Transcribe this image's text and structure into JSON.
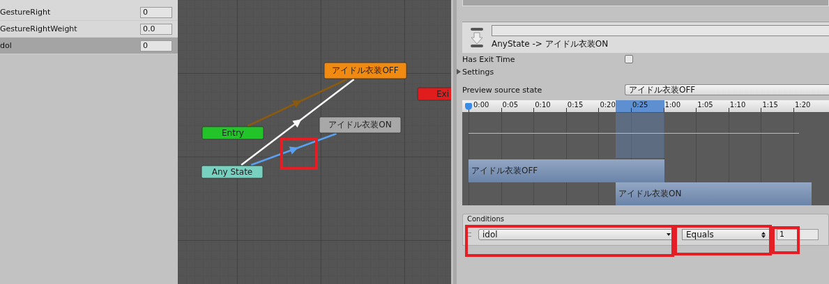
{
  "parameters": [
    {
      "name": "GestureRight",
      "value": "0",
      "selected": false
    },
    {
      "name": "GestureRightWeight",
      "value": "0.0",
      "selected": false
    },
    {
      "name": "dol",
      "value": "0",
      "selected": true
    }
  ],
  "graph": {
    "nodes": [
      {
        "label": "アイドル衣装OFF",
        "kind": "default"
      },
      {
        "label": "Exi",
        "kind": "exit"
      },
      {
        "label": "アイドル衣装ON",
        "kind": "state"
      },
      {
        "label": "Entry",
        "kind": "entry"
      },
      {
        "label": "Any State",
        "kind": "any"
      }
    ],
    "transitions": [
      {
        "kind": "default",
        "selected": false
      },
      {
        "kind": "normal",
        "selected": false
      },
      {
        "kind": "normal",
        "selected": true
      }
    ]
  },
  "inspector": {
    "transition_title": "AnyState -> アイドル衣装ON",
    "has_exit_time": {
      "label": "Has Exit Time",
      "checked": false
    },
    "settings": {
      "label": "Settings",
      "expanded": false
    },
    "preview": {
      "label": "Preview source state",
      "value": "アイドル衣装OFF"
    },
    "timeline": {
      "ticks": [
        "0:00",
        "0:05",
        "0:10",
        "0:15",
        "0:20",
        "0:25",
        "1:00",
        "1:05",
        "1:10",
        "1:15",
        "1:20"
      ],
      "clips": [
        {
          "label": "アイドル衣装OFF"
        },
        {
          "label": "アイドル衣装ON"
        }
      ]
    },
    "conditions": {
      "title": "Conditions",
      "rows": [
        {
          "parameter": "idol",
          "mode": "Equals",
          "value": "1"
        }
      ]
    }
  }
}
